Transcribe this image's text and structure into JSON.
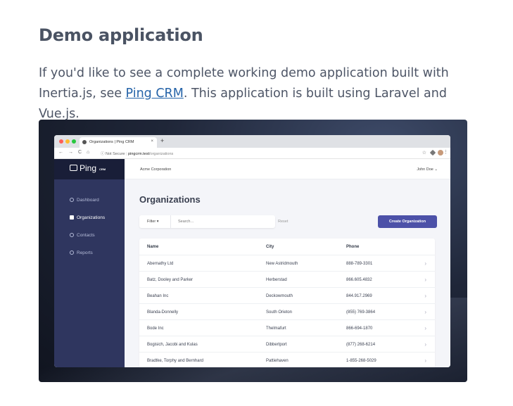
{
  "doc": {
    "title": "Demo application",
    "para_before": "If you'd like to see a complete working demo application built with Inertia.js, see ",
    "link": "Ping CRM",
    "para_after": ". This application is built using Laravel and Vue.js."
  },
  "browser": {
    "tab_title": "Organizations | Ping CRM",
    "tab_close": "×",
    "new_tab": "+",
    "back": "←",
    "forward": "→",
    "reload": "C",
    "home": "⌂",
    "not_secure": "ⓘ Not Secure",
    "url_domain": "pingcrm.test",
    "url_path": "/organizations",
    "star": "☆",
    "menu": "⋮"
  },
  "app": {
    "logo": "Ping",
    "logo_sub": "CRM",
    "account": "Acme Corporation",
    "user": "John Doe ⌄",
    "nav": [
      {
        "label": "Dashboard"
      },
      {
        "label": "Organizations"
      },
      {
        "label": "Contacts"
      },
      {
        "label": "Reports"
      }
    ],
    "page_title": "Organizations",
    "filter_label": "Filter ▾",
    "search_placeholder": "Search…",
    "reset": "Reset",
    "create_button": "Create Organization",
    "columns": [
      "Name",
      "City",
      "Phone"
    ],
    "rows": [
      [
        "Abernathy Ltd",
        "New Astridmouth",
        "888-789-3301"
      ],
      [
        "Batz, Dooley and Parker",
        "Herberstad",
        "866.605.4832"
      ],
      [
        "Beahan Inc",
        "Deckowmouth",
        "844.917.2969"
      ],
      [
        "Blanda-Donnelly",
        "South Orieton",
        "(855) 769-3864"
      ],
      [
        "Bode Inc",
        "Thelmafurt",
        "866-694-1870"
      ],
      [
        "Bogisich, Jacobi and Kulas",
        "Dibbertport",
        "(877) 268-6214"
      ],
      [
        "Bradtke, Torphy and Bernhard",
        "Pattiehaven",
        "1-855-268-5029"
      ]
    ],
    "chevron": "›"
  }
}
